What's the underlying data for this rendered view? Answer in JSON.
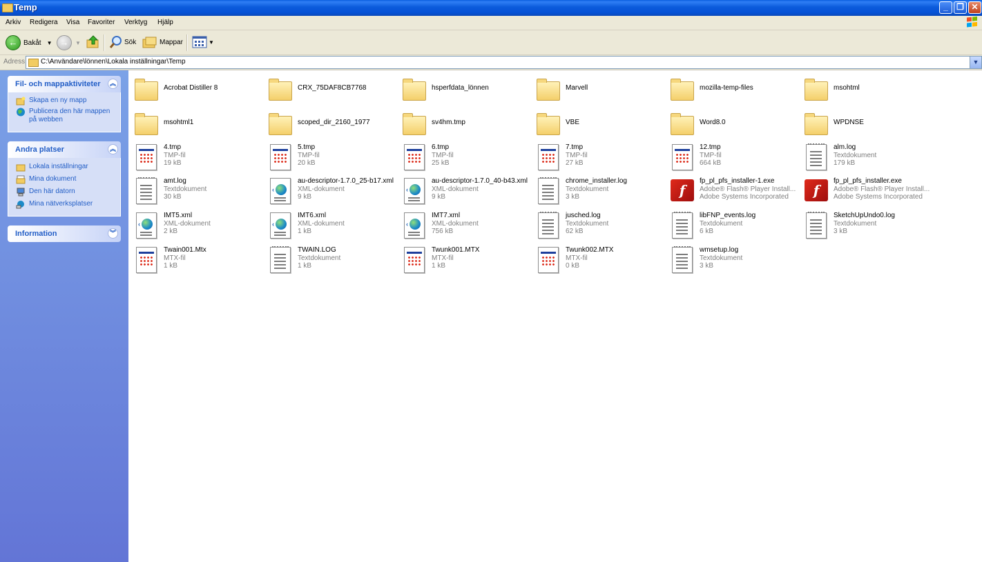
{
  "window": {
    "title": "Temp"
  },
  "menu": [
    "Arkiv",
    "Redigera",
    "Visa",
    "Favoriter",
    "Verktyg",
    "Hjälp"
  ],
  "toolbar": {
    "back_label": "Bakåt",
    "search_label": "Sök",
    "folders_label": "Mappar"
  },
  "address": {
    "label": "Adress",
    "path": "C:\\Användare\\lönnen\\Lokala inställningar\\Temp"
  },
  "sidebar": {
    "tasks": {
      "title": "Fil- och mappaktiviteter",
      "items": [
        "Skapa en ny mapp",
        "Publicera den här mappen",
        "på webben"
      ]
    },
    "places": {
      "title": "Andra platser",
      "items": [
        "Lokala inställningar",
        "Mina dokument",
        "Den här datorn",
        "Mina nätverksplatser"
      ]
    },
    "info": {
      "title": "Information"
    }
  },
  "files": [
    {
      "name": "Acrobat Distiller 8",
      "kind": "folder"
    },
    {
      "name": "CRX_75DAF8CB7768",
      "kind": "folder"
    },
    {
      "name": "hsperfdata_lönnen",
      "kind": "folder"
    },
    {
      "name": "Marvell",
      "kind": "folder"
    },
    {
      "name": "mozilla-temp-files",
      "kind": "folder"
    },
    {
      "name": "msohtml",
      "kind": "folder"
    },
    {
      "name": "msohtml1",
      "kind": "folder"
    },
    {
      "name": "scoped_dir_2160_1977",
      "kind": "folder"
    },
    {
      "name": "sv4hm.tmp",
      "kind": "folder"
    },
    {
      "name": "VBE",
      "kind": "folder"
    },
    {
      "name": "Word8.0",
      "kind": "folder"
    },
    {
      "name": "WPDNSE",
      "kind": "folder"
    },
    {
      "name": "4.tmp",
      "type": "TMP-fil",
      "size": "19 kB",
      "kind": "tmp"
    },
    {
      "name": "5.tmp",
      "type": "TMP-fil",
      "size": "20 kB",
      "kind": "tmp"
    },
    {
      "name": "6.tmp",
      "type": "TMP-fil",
      "size": "25 kB",
      "kind": "tmp"
    },
    {
      "name": "7.tmp",
      "type": "TMP-fil",
      "size": "27 kB",
      "kind": "tmp"
    },
    {
      "name": "12.tmp",
      "type": "TMP-fil",
      "size": "664 kB",
      "kind": "tmp"
    },
    {
      "name": "alm.log",
      "type": "Textdokument",
      "size": "179 kB",
      "kind": "txt"
    },
    {
      "name": "amt.log",
      "type": "Textdokument",
      "size": "30 kB",
      "kind": "txt"
    },
    {
      "name": "au-descriptor-1.7.0_25-b17.xml",
      "type": "XML-dokument",
      "size": "9 kB",
      "kind": "xml"
    },
    {
      "name": "au-descriptor-1.7.0_40-b43.xml",
      "type": "XML-dokument",
      "size": "9 kB",
      "kind": "xml"
    },
    {
      "name": "chrome_installer.log",
      "type": "Textdokument",
      "size": "3 kB",
      "kind": "txt"
    },
    {
      "name": "fp_pl_pfs_installer-1.exe",
      "type": "Adobe® Flash® Player Install...",
      "size": "Adobe Systems Incorporated",
      "kind": "flash"
    },
    {
      "name": "fp_pl_pfs_installer.exe",
      "type": "Adobe® Flash® Player Install...",
      "size": "Adobe Systems Incorporated",
      "kind": "flash"
    },
    {
      "name": "IMT5.xml",
      "type": "XML-dokument",
      "size": "2 kB",
      "kind": "xml"
    },
    {
      "name": "IMT6.xml",
      "type": "XML-dokument",
      "size": "1 kB",
      "kind": "xml"
    },
    {
      "name": "IMT7.xml",
      "type": "XML-dokument",
      "size": "756 kB",
      "kind": "xml"
    },
    {
      "name": "jusched.log",
      "type": "Textdokument",
      "size": "62 kB",
      "kind": "txt"
    },
    {
      "name": "libFNP_events.log",
      "type": "Textdokument",
      "size": "6 kB",
      "kind": "txt"
    },
    {
      "name": "SketchUpUndo0.log",
      "type": "Textdokument",
      "size": "3 kB",
      "kind": "txt"
    },
    {
      "name": "Twain001.Mtx",
      "type": "MTX-fil",
      "size": "1 kB",
      "kind": "tmp"
    },
    {
      "name": "TWAIN.LOG",
      "type": "Textdokument",
      "size": "1 kB",
      "kind": "txt"
    },
    {
      "name": "Twunk001.MTX",
      "type": "MTX-fil",
      "size": "1 kB",
      "kind": "tmp"
    },
    {
      "name": "Twunk002.MTX",
      "type": "MTX-fil",
      "size": "0 kB",
      "kind": "tmp"
    },
    {
      "name": "wmsetup.log",
      "type": "Textdokument",
      "size": "3 kB",
      "kind": "txt"
    }
  ]
}
